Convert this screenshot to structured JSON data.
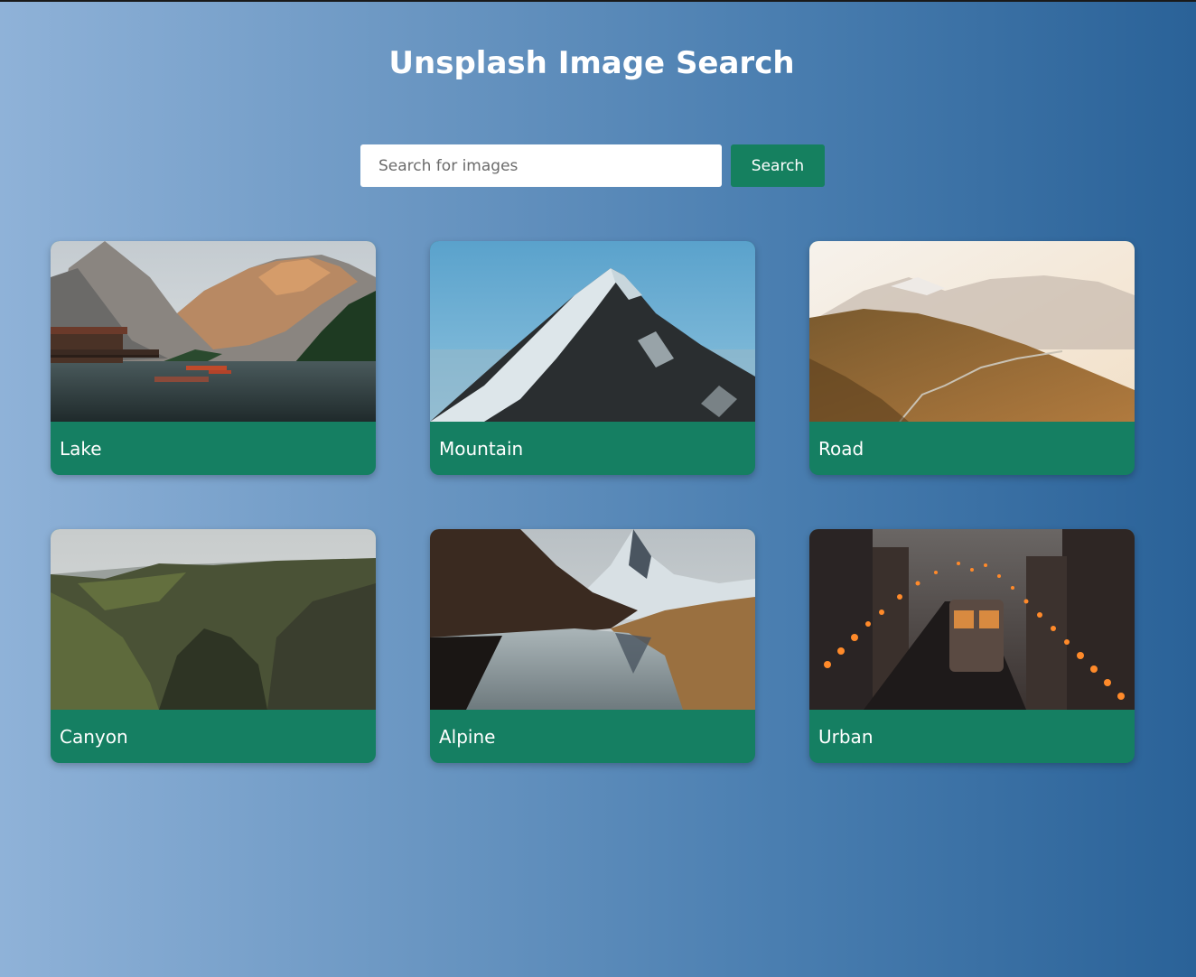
{
  "header": {
    "title": "Unsplash Image Search"
  },
  "search": {
    "placeholder": "Search for images",
    "value": "",
    "button_label": "Search"
  },
  "results": [
    {
      "label": "Lake"
    },
    {
      "label": "Mountain"
    },
    {
      "label": "Road"
    },
    {
      "label": "Canyon"
    },
    {
      "label": "Alpine"
    },
    {
      "label": "Urban"
    }
  ],
  "colors": {
    "accent": "#15805f",
    "background_start": "#8fb2d8",
    "background_end": "#2a6298"
  }
}
